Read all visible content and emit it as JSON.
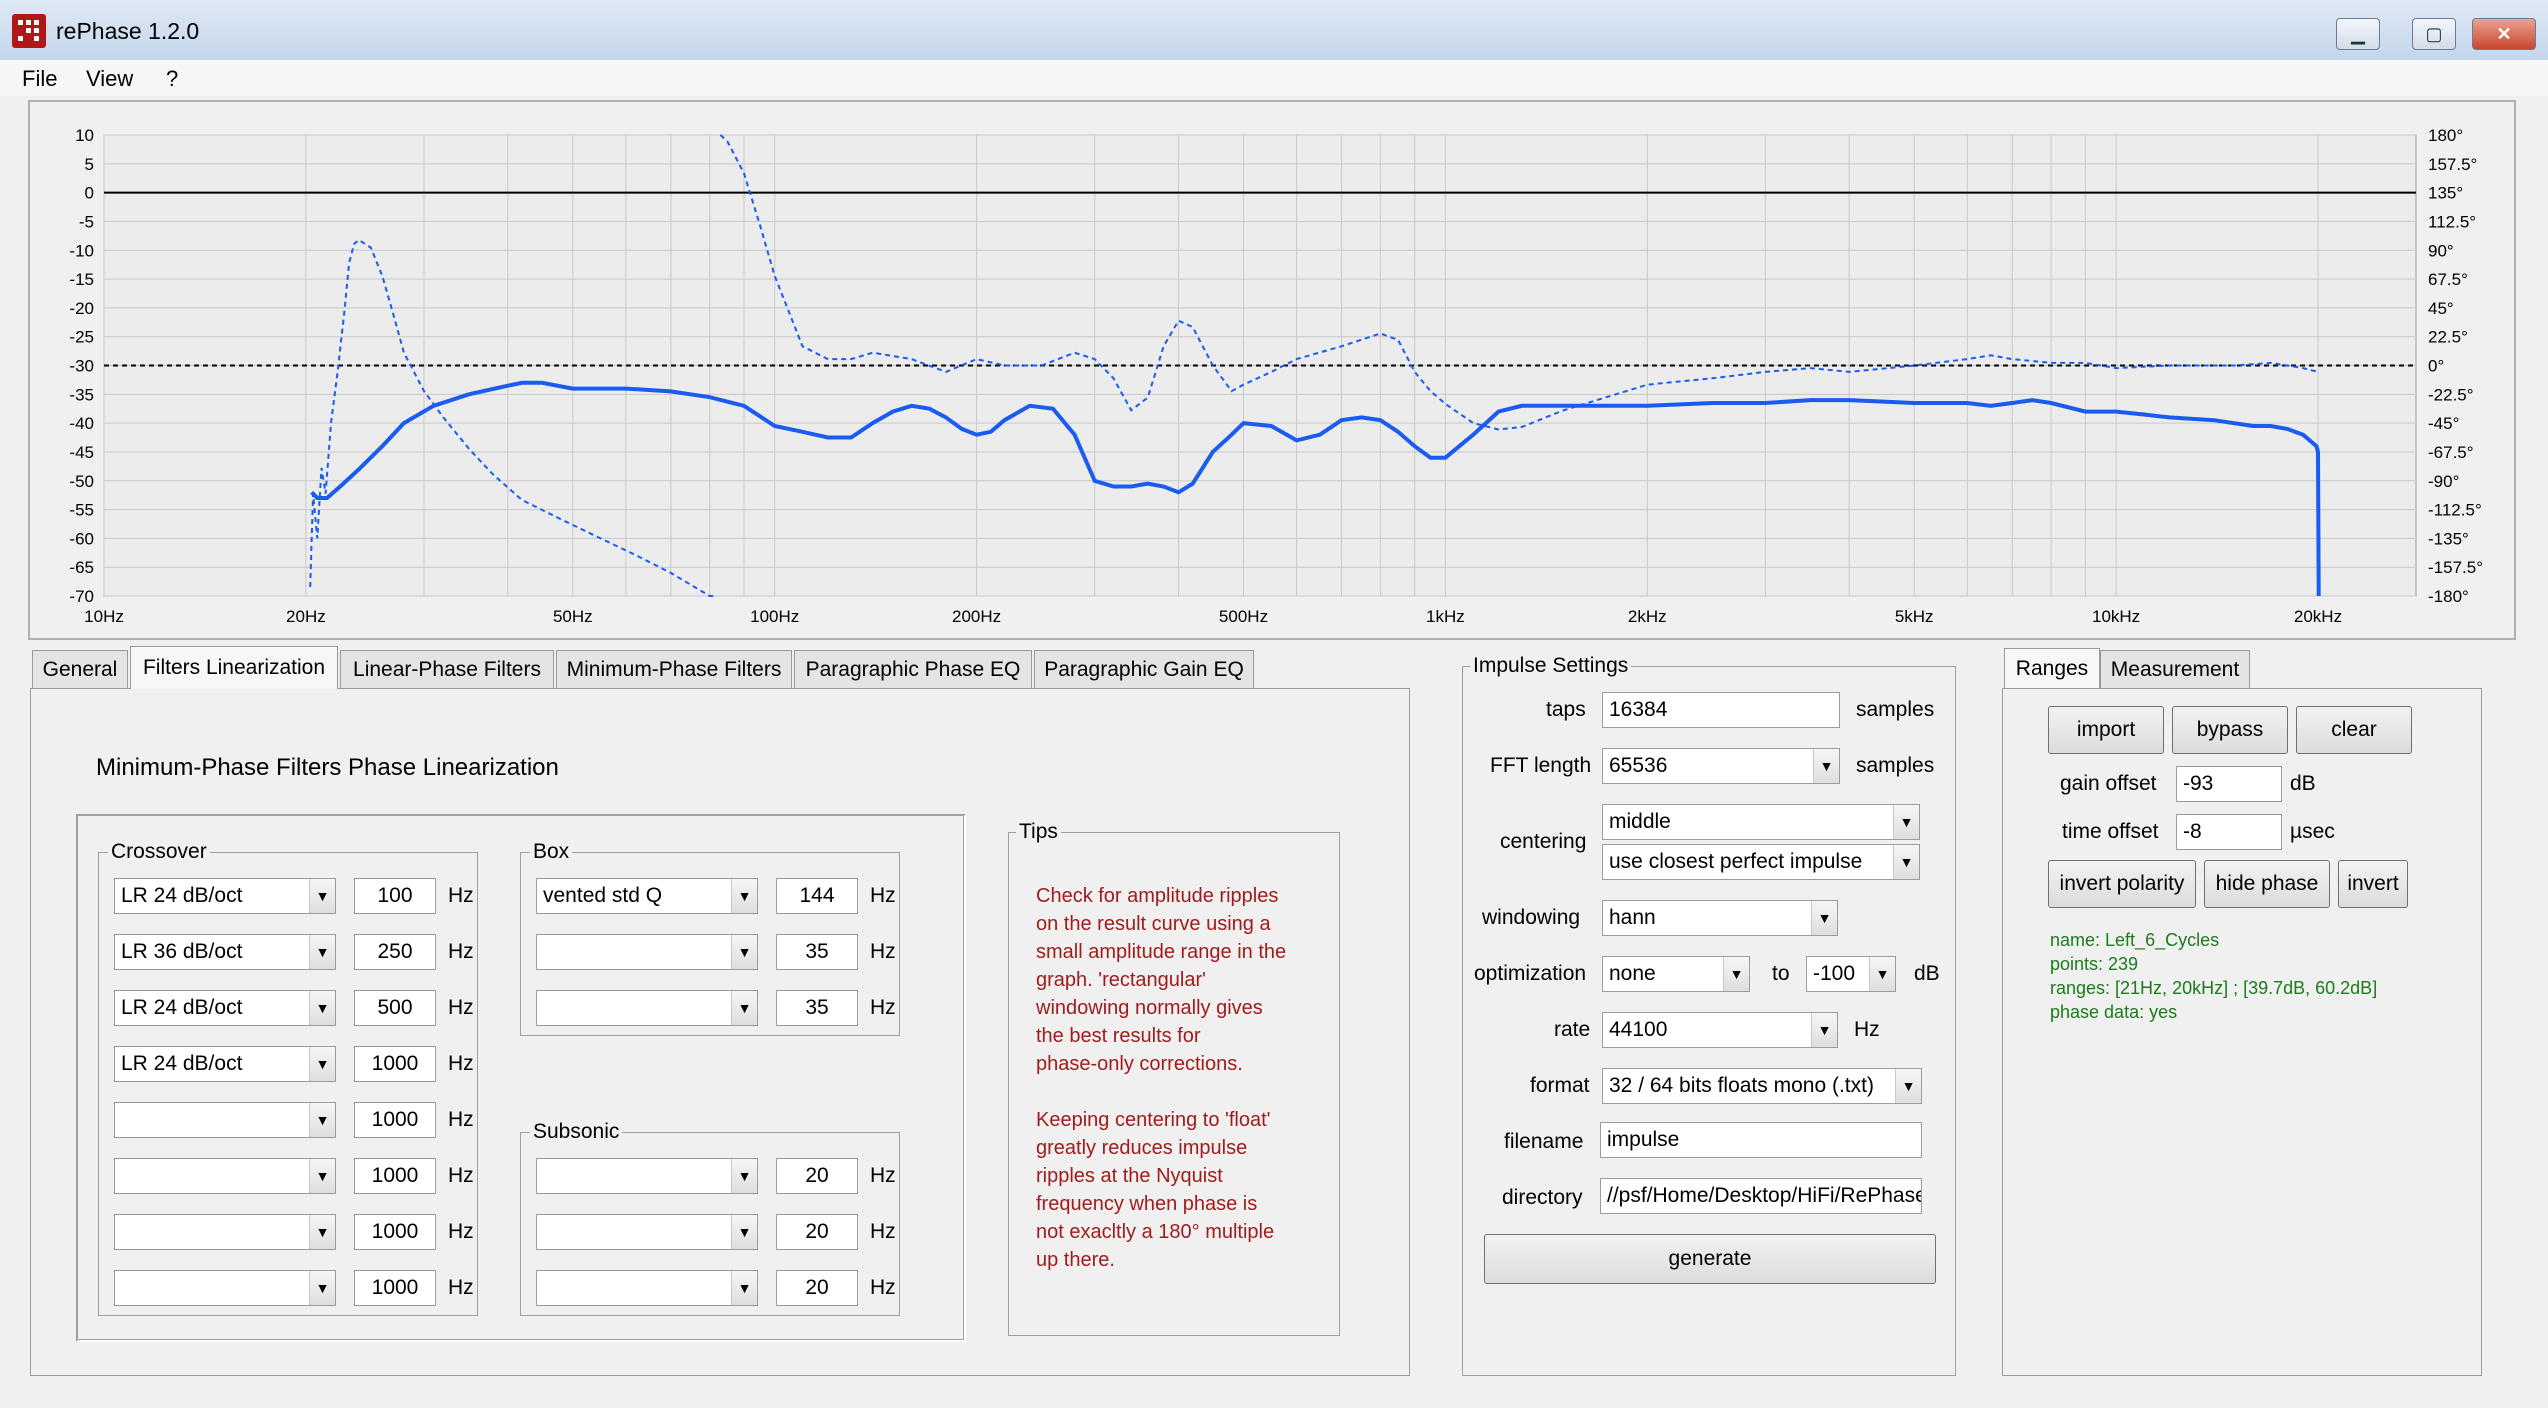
{
  "window": {
    "title": "rePhase 1.2.0",
    "min": "▁",
    "max": "▢",
    "close": "✕"
  },
  "menu": [
    "File",
    "View",
    "?"
  ],
  "graph": {
    "left_ticks": [
      "10",
      "5",
      "0",
      "-5",
      "-10",
      "-15",
      "-20",
      "-25",
      "-30",
      "-35",
      "-40",
      "-45",
      "-50",
      "-55",
      "-60",
      "-65",
      "-70"
    ],
    "right_ticks": [
      "180°",
      "157.5°",
      "135°",
      "112.5°",
      "90°",
      "67.5°",
      "45°",
      "22.5°",
      "0°",
      "-22.5°",
      "-45°",
      "-67.5°",
      "-90°",
      "-112.5°",
      "-135°",
      "-157.5°",
      "-180°"
    ],
    "x_ticks": [
      "10Hz",
      "20Hz",
      "50Hz",
      "100Hz",
      "200Hz",
      "500Hz",
      "1kHz",
      "2kHz",
      "5kHz",
      "10kHz",
      "20kHz"
    ],
    "colors": {
      "curve": "#1a5cf0",
      "grid": "#c8c8c8",
      "plot_bg": "#ececec"
    }
  },
  "chart_data": {
    "type": "line",
    "xlabel": "",
    "ylabel": "",
    "xscale": "log",
    "xlim": [
      10,
      28000
    ],
    "ylim_left": [
      -70,
      10
    ],
    "ylim_right": [
      -180,
      180
    ],
    "grid": true,
    "series": [
      {
        "axis": "left",
        "style": "solid",
        "x": [
          20.4,
          20.8,
          21.5,
          22.5,
          24,
          26,
          28,
          31,
          35,
          40,
          42,
          45,
          50,
          55,
          60,
          70,
          80,
          90,
          100,
          110,
          120,
          130,
          140,
          150,
          160,
          170,
          180,
          190,
          200,
          210,
          220,
          240,
          260,
          280,
          300,
          320,
          340,
          360,
          380,
          400,
          420,
          450,
          480,
          500,
          550,
          600,
          650,
          700,
          750,
          800,
          850,
          900,
          950,
          1000,
          1100,
          1200,
          1300,
          1500,
          2000,
          2500,
          3000,
          3500,
          4000,
          5000,
          6000,
          6500,
          7000,
          7500,
          8000,
          9000,
          10000,
          11000,
          12000,
          14000,
          16000,
          17000,
          18000,
          19000,
          19900,
          20000,
          20050
        ],
        "y": [
          -52,
          -53,
          -53,
          -51,
          -48,
          -44,
          -40,
          -37,
          -35,
          -33.5,
          -33,
          -33,
          -34,
          -34,
          -34,
          -34.5,
          -35.5,
          -37,
          -40.5,
          -41.5,
          -42.5,
          -42.5,
          -40,
          -38,
          -37,
          -37.5,
          -39,
          -41,
          -42,
          -41.5,
          -39.5,
          -37,
          -37.5,
          -42,
          -50,
          -51,
          -51,
          -50.5,
          -51,
          -52,
          -50.5,
          -45,
          -42,
          -40,
          -40.5,
          -43,
          -42,
          -39.5,
          -39,
          -39.5,
          -41.5,
          -44,
          -46,
          -46,
          -42,
          -38,
          -37,
          -37,
          -37,
          -36.5,
          -36.5,
          -36,
          -36,
          -36.5,
          -36.5,
          -37,
          -36.5,
          -36,
          -36.5,
          -38,
          -38,
          -38.5,
          -39,
          -39.5,
          -40.5,
          -40.5,
          -41,
          -42,
          -44,
          -45,
          -70
        ]
      },
      {
        "axis": "right",
        "style": "dashed",
        "x": [
          20.3,
          20.5,
          20.8,
          21.1,
          21.4,
          21.8,
          22.3,
          22.8,
          23.2,
          23.6,
          24,
          25,
          26,
          27,
          28,
          30,
          32,
          35,
          38,
          42,
          48,
          55,
          62,
          70,
          80,
          82,
          83,
          85,
          90,
          95,
          100,
          110,
          120,
          130,
          140,
          160,
          180,
          200,
          220,
          250,
          280,
          300,
          320,
          340,
          360,
          380,
          400,
          420,
          450,
          480,
          500,
          550,
          600,
          700,
          800,
          850,
          900,
          950,
          1000,
          1100,
          1200,
          1300,
          1500,
          2000,
          2500,
          3000,
          3500,
          4000,
          5000,
          6000,
          6500,
          7000,
          8000,
          9000,
          10000,
          12000,
          15000,
          17000,
          18000,
          19000,
          20000
        ],
        "y": [
          -173,
          -100,
          -135,
          -80,
          -100,
          -45,
          -5,
          40,
          80,
          95,
          98,
          92,
          70,
          40,
          10,
          -20,
          -40,
          -65,
          -85,
          -105,
          -120,
          -135,
          -148,
          -162,
          -180,
          -180,
          180,
          175,
          150,
          110,
          70,
          15,
          5,
          5,
          10,
          5,
          -5,
          5,
          0,
          0,
          10,
          5,
          -10,
          -35,
          -25,
          15,
          35,
          30,
          0,
          -20,
          -15,
          -5,
          5,
          15,
          25,
          20,
          -5,
          -20,
          -30,
          -45,
          -50,
          -48,
          -35,
          -15,
          -10,
          -5,
          -2,
          -5,
          0,
          5,
          8,
          5,
          2,
          2,
          -2,
          0,
          0,
          2,
          0,
          -2,
          -5
        ]
      }
    ]
  },
  "tabs": [
    "General",
    "Filters Linearization",
    "Linear-Phase Filters",
    "Minimum-Phase Filters",
    "Paragraphic Phase EQ",
    "Paragraphic Gain EQ"
  ],
  "filters": {
    "heading": "Minimum-Phase Filters Phase Linearization",
    "crossover_label": "Crossover",
    "box_label": "Box",
    "subsonic_label": "Subsonic",
    "hz": "Hz",
    "crossover": [
      {
        "type": "LR  24 dB/oct",
        "freq": "100"
      },
      {
        "type": "LR  36 dB/oct",
        "freq": "250"
      },
      {
        "type": "LR  24 dB/oct",
        "freq": "500"
      },
      {
        "type": "LR  24 dB/oct",
        "freq": "1000"
      },
      {
        "type": "",
        "freq": "1000"
      },
      {
        "type": "",
        "freq": "1000"
      },
      {
        "type": "",
        "freq": "1000"
      },
      {
        "type": "",
        "freq": "1000"
      }
    ],
    "box": [
      {
        "type": "vented std Q",
        "freq": "144"
      },
      {
        "type": "",
        "freq": "35"
      },
      {
        "type": "",
        "freq": "35"
      }
    ],
    "subsonic": [
      {
        "type": "",
        "freq": "20"
      },
      {
        "type": "",
        "freq": "20"
      },
      {
        "type": "",
        "freq": "20"
      }
    ],
    "tips_label": "Tips",
    "tips_p1": [
      "Check for amplitude ripples",
      "on the result curve using a",
      "small amplitude range in the",
      "graph. 'rectangular'",
      "windowing normally gives",
      "the best results for",
      "phase-only corrections."
    ],
    "tips_p2": [
      "Keeping centering to 'float'",
      "greatly reduces impulse",
      "ripples at the Nyquist",
      "frequency when phase is",
      "not exacltly a 180° multiple",
      "up there."
    ]
  },
  "impulse": {
    "group_label": "Impulse Settings",
    "taps_label": "taps",
    "taps": "16384",
    "samples": "samples",
    "fft_label": "FFT length",
    "fft": "65536",
    "centering_label": "centering",
    "centering": "middle",
    "centering2": "use closest perfect impulse",
    "windowing_label": "windowing",
    "windowing": "hann",
    "optimization_label": "optimization",
    "optimization": "none",
    "to": "to",
    "opt_db": "-100",
    "db": "dB",
    "rate_label": "rate",
    "rate": "44100",
    "hz": "Hz",
    "format_label": "format",
    "format": "32 / 64 bits floats mono (.txt)",
    "filename_label": "filename",
    "filename": "impulse",
    "directory_label": "directory",
    "directory": "//psf/Home/Desktop/HiFi/RePhase",
    "generate": "generate"
  },
  "measurement": {
    "tabs": [
      "Ranges",
      "Measurement"
    ],
    "import": "import",
    "bypass": "bypass",
    "clear": "clear",
    "gain_offset_label": "gain offset",
    "gain_offset": "-93",
    "db": "dB",
    "time_offset_label": "time offset",
    "time_offset": "-8",
    "usec": "µsec",
    "invert_polarity": "invert polarity",
    "hide_phase": "hide phase",
    "invert": "invert",
    "info": [
      "name: Left_6_Cycles",
      "points: 239",
      "ranges: [21Hz, 20kHz] ; [39.7dB, 60.2dB]",
      "phase data: yes"
    ]
  }
}
